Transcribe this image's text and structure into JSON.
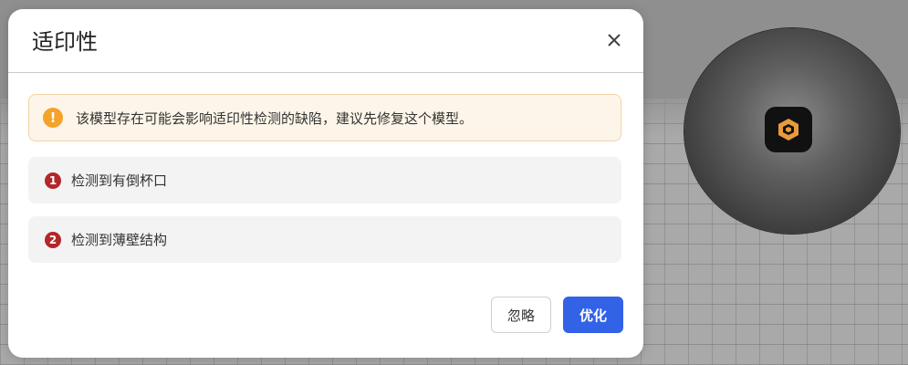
{
  "dialog": {
    "title": "适印性",
    "close_icon": "close-icon",
    "warning": {
      "icon": "!",
      "text": "该模型存在可能会影响适印性检测的缺陷，建议先修复这个模型。"
    },
    "issues": [
      {
        "number": "1",
        "text": "检测到有倒杯口"
      },
      {
        "number": "2",
        "text": "检测到薄壁结构"
      }
    ],
    "buttons": {
      "ignore_label": "忽略",
      "optimize_label": "优化"
    }
  },
  "colors": {
    "primary": "#3262e6",
    "warning": "#f4a328",
    "warning_bg": "#fdf5e9",
    "issue_badge": "#b3262a",
    "model_icon": "#e89a3c"
  }
}
